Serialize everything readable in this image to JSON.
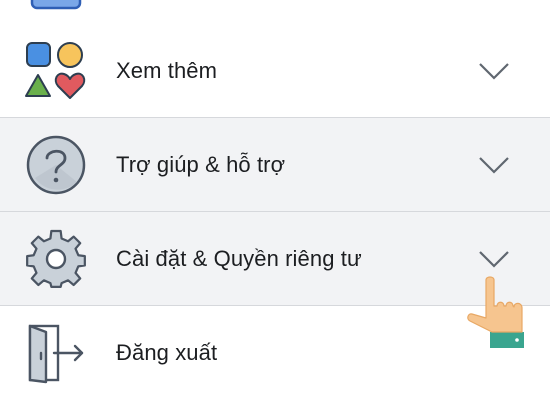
{
  "menu": {
    "items": [
      {
        "label": "Xem thêm",
        "icon": "shapes-icon",
        "expandable": true
      },
      {
        "label": "Trợ giúp & hỗ trợ",
        "icon": "help-icon",
        "expandable": true
      },
      {
        "label": "Cài đặt & Quyền riêng tư",
        "icon": "gear-icon",
        "expandable": true
      },
      {
        "label": "Đăng xuất",
        "icon": "logout-door-icon",
        "expandable": false
      }
    ]
  },
  "colors": {
    "row_grey": "#f2f3f5",
    "divider": "#d6d8dc",
    "text": "#1c1e21",
    "chevron": "#606770",
    "shape_blue": "#4a90e2",
    "shape_yellow": "#f7c45c",
    "shape_green": "#6ab04c",
    "shape_red": "#e05a5f",
    "icon_grey": "#c9d1d9",
    "icon_stroke": "#4b5563"
  }
}
